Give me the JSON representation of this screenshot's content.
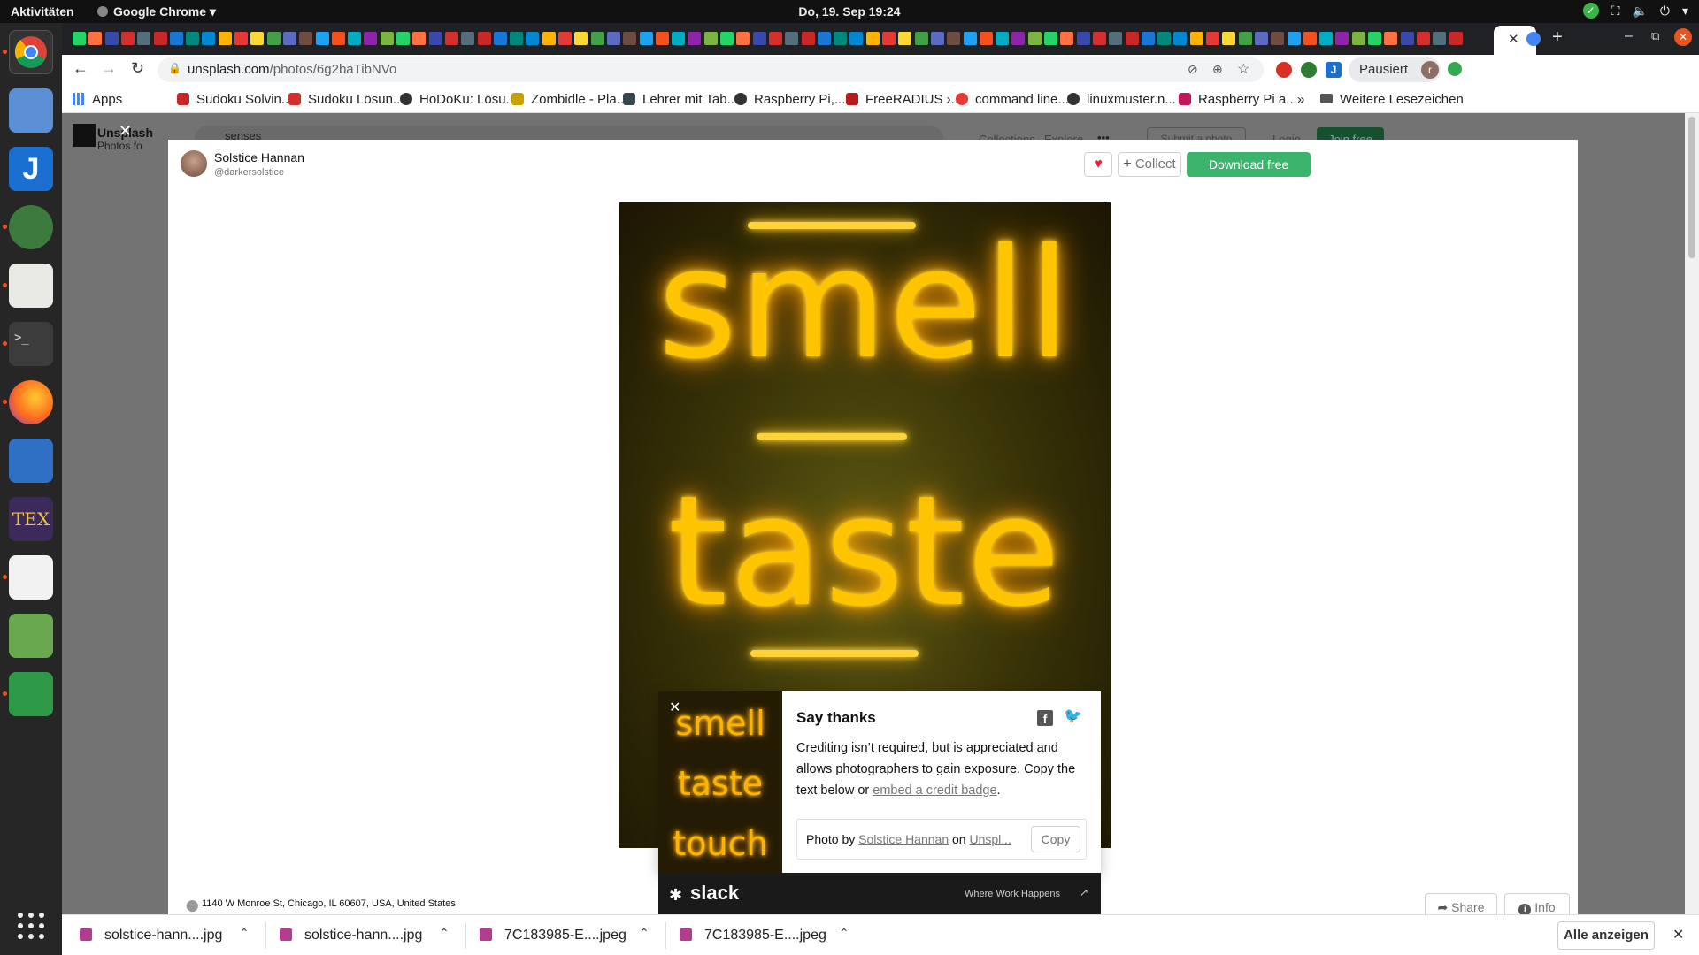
{
  "system": {
    "activities": "Aktivitäten",
    "app_name": "Google Chrome",
    "clock": "Do, 19. Sep  19:24"
  },
  "browser": {
    "url_domain": "unsplash.com",
    "url_path": "/photos/6g2baTibNVo",
    "profile_label": "Pausiert",
    "profile_initial": "r"
  },
  "bookmarks": {
    "apps": "Apps",
    "items": [
      "Sudoku Solvin...",
      "Sudoku Lösun...",
      "HoDoKu: Lösu...",
      "Zombidle - Pla...",
      "Lehrer mit Tab...",
      "Raspberry Pi,...",
      "FreeRADIUS ›...",
      "command line...",
      "linuxmuster.n...",
      "Raspberry Pi a..."
    ],
    "more": "»",
    "other_folder": "Weitere Lesezeichen"
  },
  "unsplash_header": {
    "brand": "Unsplash",
    "tagline": "Photos fo",
    "search_value": "senses",
    "nav": [
      "Collections",
      "Explore",
      "•••"
    ],
    "submit": "Submit a photo",
    "login": "Login",
    "join": "Join free"
  },
  "photo_modal": {
    "close_glyph": "✕",
    "author_name": "Solstice Hannan",
    "author_handle": "@darkersolstice",
    "collect_label": "Collect",
    "download_label": "Download free",
    "photo_words": [
      "smell",
      "taste"
    ],
    "location": "1140 W Monroe St, Chicago, IL 60607, USA, United States",
    "share_label": "Share",
    "info_label": "Info"
  },
  "say_thanks": {
    "close_glyph": "✕",
    "title": "Say thanks",
    "body_before_link": "Crediting isn’t required, but is appreciated and allows photographers to gain exposure. Copy the text below or ",
    "link": "embed a credit badge",
    "body_after_link": ".",
    "credit_prefix": "Photo by ",
    "credit_author": "Solstice Hannan",
    "credit_mid": " on ",
    "credit_site": "Unspl...",
    "copy_label": "Copy",
    "thumb_words": [
      "smell",
      "taste",
      "touch"
    ]
  },
  "ad": {
    "brand": "slack",
    "tagline": "Where Work Happens"
  },
  "downloads": {
    "items": [
      "solstice-hann....jpg",
      "solstice-hann....jpg",
      "7C183985-E....jpeg",
      "7C183985-E....jpeg"
    ],
    "show_all": "Alle anzeigen"
  },
  "colors": {
    "download_green": "#3cb46e",
    "heart_red": "#e0243e",
    "neon_yellow": "#ffc400",
    "dock_bg": "#262626",
    "tabstrip_bg": "#202124"
  }
}
